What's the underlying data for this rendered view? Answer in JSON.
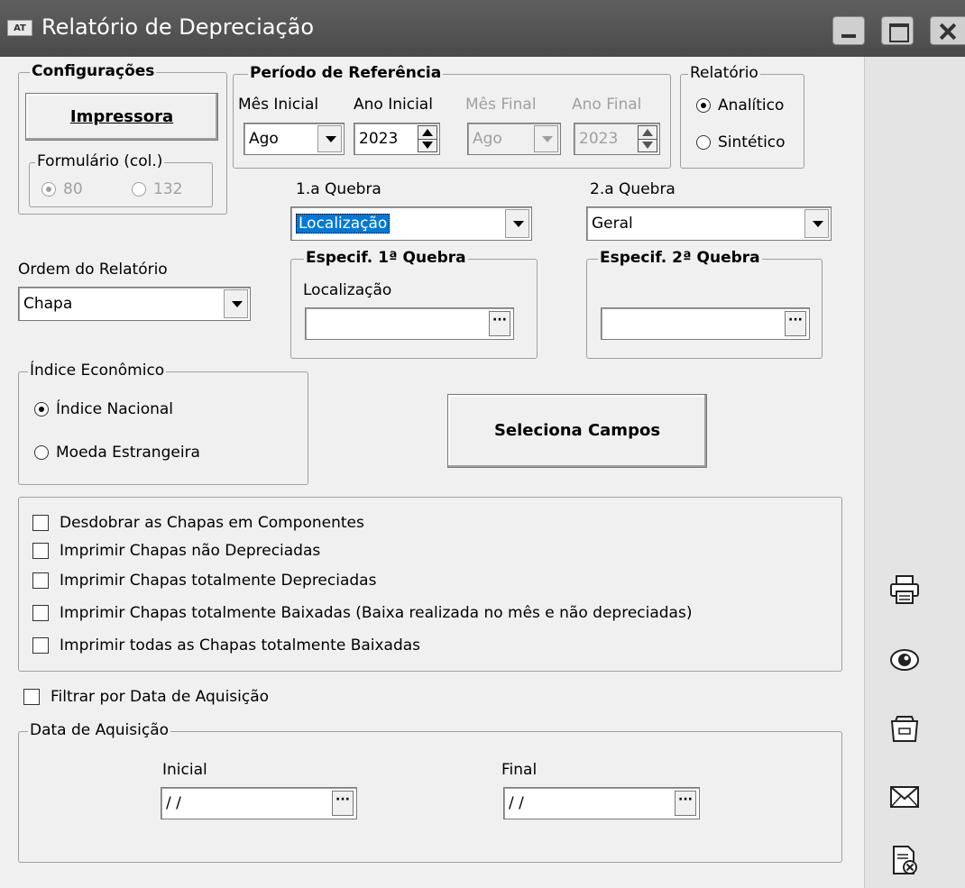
{
  "window": {
    "title": "Relatório de Depreciação",
    "icon_text": "AT"
  },
  "config": {
    "legend": "Configurações",
    "printer_button": "Impressora",
    "form": {
      "legend": "Formulário (col.)",
      "opt80": "80",
      "opt132": "132",
      "selected": "80"
    }
  },
  "periodo": {
    "legend": "Período de Referência",
    "mes_inicial_label": "Mês Inicial",
    "mes_inicial": "Ago",
    "ano_inicial_label": "Ano Inicial",
    "ano_inicial": "2023",
    "mes_final_label": "Mês Final",
    "mes_final": "Ago",
    "ano_final_label": "Ano Final",
    "ano_final": "2023"
  },
  "relatorio": {
    "legend": "Relatório",
    "analitico": "Analítico",
    "sintetico": "Sintético",
    "selected": "Analítico"
  },
  "quebra1": {
    "label": "1.a Quebra",
    "value": "Localização"
  },
  "quebra2": {
    "label": "2.a Quebra",
    "value": "Geral"
  },
  "ordem": {
    "label": "Ordem do Relatório",
    "value": "Chapa"
  },
  "espec1": {
    "legend": "Especif. 1ª Quebra",
    "sublabel": "Localização",
    "value": ""
  },
  "espec2": {
    "legend": "Especif. 2ª Quebra",
    "value": ""
  },
  "indice": {
    "legend": "Índice Econômico",
    "nacional": "Índice Nacional",
    "estrangeira": "Moeda Estrangeira",
    "selected": "Índice Nacional"
  },
  "seleciona_button": "Seleciona Campos",
  "options": [
    "Desdobrar as Chapas em Componentes",
    "Imprimir Chapas não Depreciadas",
    "Imprimir Chapas totalmente Depreciadas",
    "Imprimir Chapas totalmente Baixadas (Baixa realizada no mês e não depreciadas)",
    "Imprimir todas as Chapas totalmente Baixadas"
  ],
  "filtrar": "Filtrar por Data de Aquisição",
  "data_aquisicao": {
    "legend": "Data de Aquisição",
    "inicial_label": "Inicial",
    "inicial": "/ /",
    "final_label": "Final",
    "final": "/ /"
  },
  "side_icons": [
    "printer-icon",
    "preview-eye-icon",
    "file-cabinet-icon",
    "email-envelope-icon",
    "cancel-document-icon"
  ]
}
